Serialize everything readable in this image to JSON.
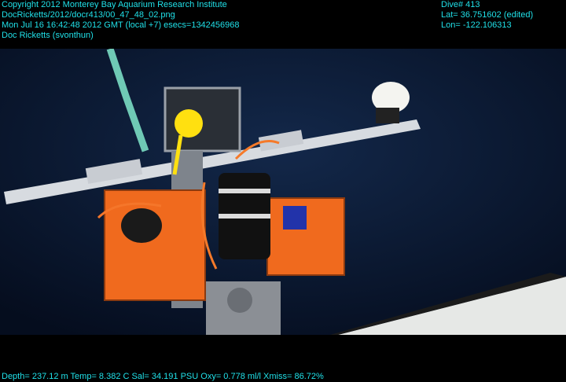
{
  "header_left": {
    "line1": "Copyright 2012 Monterey Bay Aquarium Research Institute",
    "line2": "DocRicketts/2012/docr413/00_47_48_02.png",
    "line3": "Mon Jul 16 16:42:48 2012 GMT (local +7)  esecs=1342456968",
    "line4": "Doc Ricketts (svonthun)"
  },
  "header_right": {
    "dive": "Dive# 413",
    "lat": "Lat= 36.751602 (edited)",
    "lon": "Lon= -122.106313"
  },
  "footer": {
    "telemetry": "Depth= 237.12 m  Temp= 8.382 C  Sal= 34.191 PSU  Oxy= 0.778 ml/l  Xmiss= 86.72%"
  },
  "colors": {
    "overlay_text": "#20e0e8",
    "water": "#0b1a33",
    "instrument_orange": "#f06a1e"
  }
}
